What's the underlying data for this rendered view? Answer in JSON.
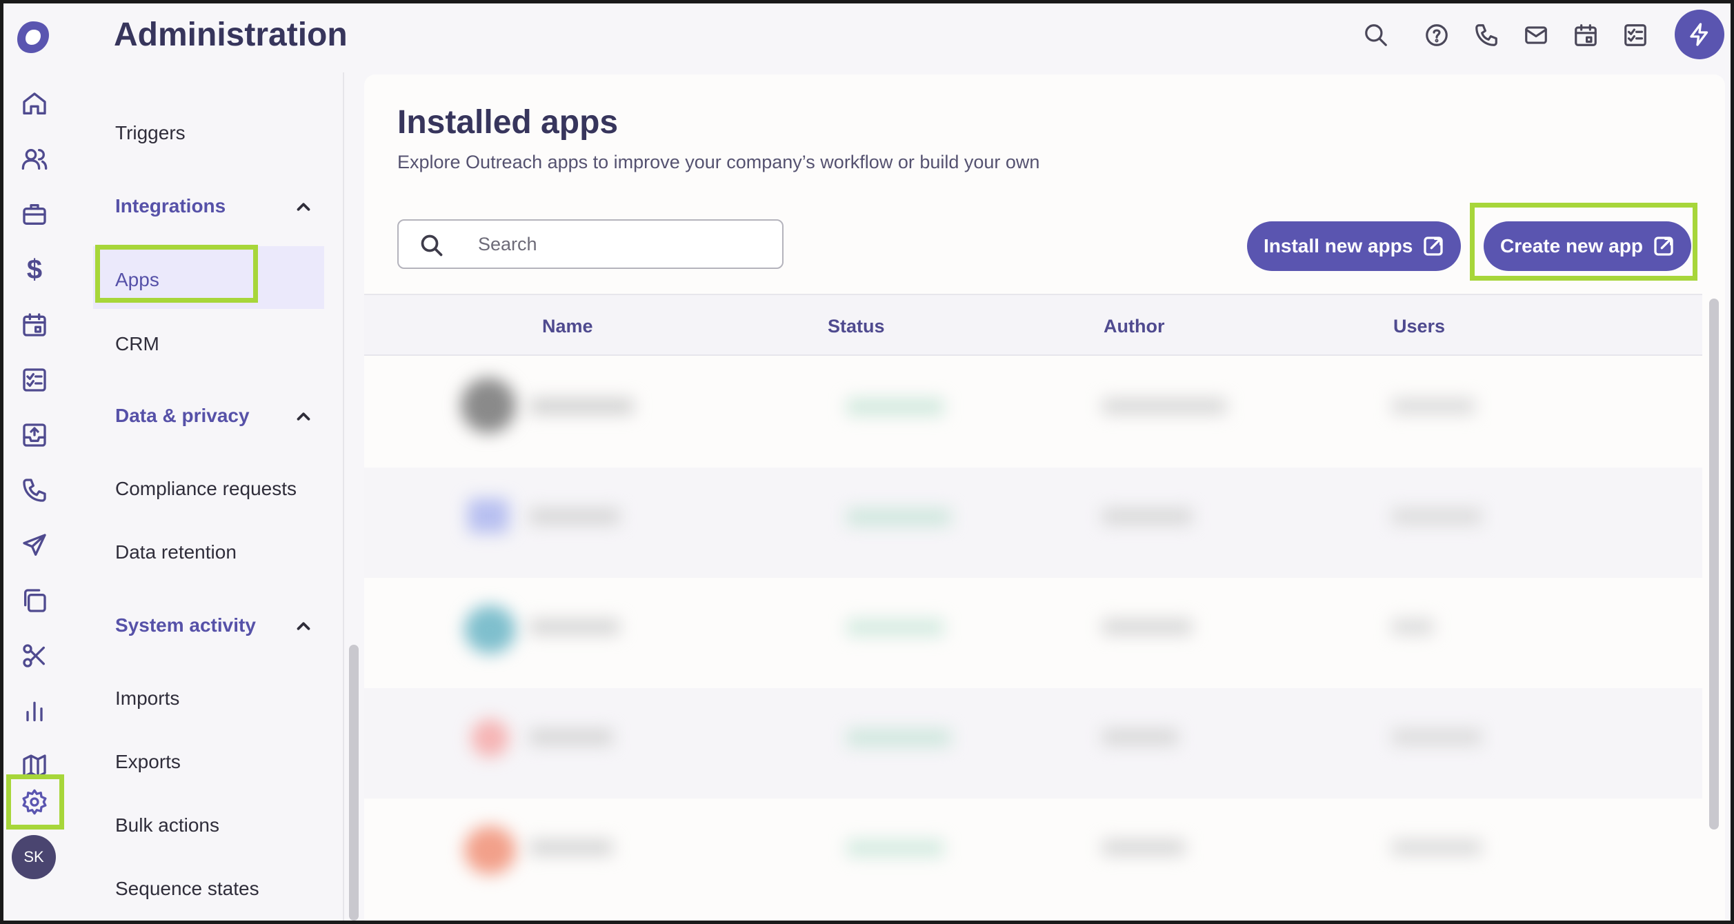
{
  "header": {
    "title": "Administration",
    "icons": [
      "search-icon",
      "help-icon",
      "phone-icon",
      "mail-icon",
      "calendar-icon",
      "tasks-icon",
      "bolt-icon"
    ]
  },
  "rail": {
    "icons": [
      "home-icon",
      "people-icon",
      "briefcase-icon",
      "dollar-icon",
      "calendar-icon",
      "tasks-icon",
      "inbox-upload-icon",
      "phone-icon",
      "send-icon",
      "copy-icon",
      "scissors-icon",
      "bar-chart-icon",
      "map-icon",
      "gear-icon"
    ],
    "avatar": "SK",
    "accent": "#5a55b0",
    "highlight": "#a7d63a"
  },
  "nav": {
    "triggers": "Triggers",
    "integrations": "Integrations",
    "apps": "Apps",
    "crm": "CRM",
    "data_privacy": "Data & privacy",
    "compliance": "Compliance requests",
    "retention": "Data retention",
    "system_activity": "System activity",
    "imports": "Imports",
    "exports": "Exports",
    "bulk": "Bulk actions",
    "sequence_states": "Sequence states"
  },
  "main": {
    "title": "Installed apps",
    "subtitle": "Explore Outreach apps to improve your company’s workflow or build your own",
    "search_placeholder": "Search",
    "install_button": "Install new apps",
    "create_button": "Create new app",
    "columns": [
      "Name",
      "Status",
      "Author",
      "Users"
    ]
  }
}
